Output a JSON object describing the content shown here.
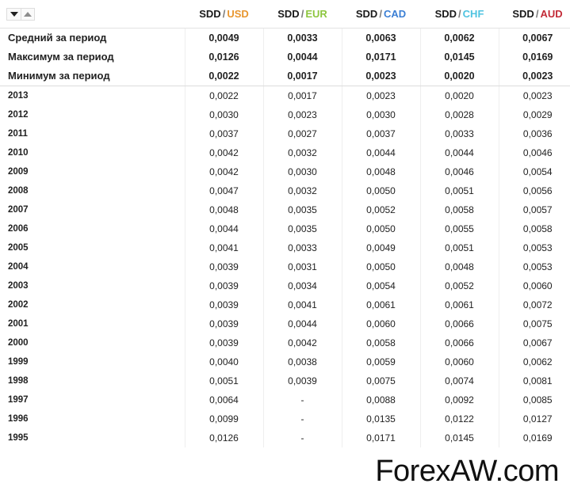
{
  "header": {
    "sort_desc_label": "▼",
    "sort_asc_label": "▲",
    "columns": [
      {
        "base": "SDD",
        "separator": "/",
        "quote": "USD",
        "color": "#E8962E"
      },
      {
        "base": "SDD",
        "separator": "/",
        "quote": "EUR",
        "color": "#8DC63F"
      },
      {
        "base": "SDD",
        "separator": "/",
        "quote": "CAD",
        "color": "#3B7FD4"
      },
      {
        "base": "SDD",
        "separator": "/",
        "quote": "CHF",
        "color": "#4EC3E0"
      },
      {
        "base": "SDD",
        "separator": "/",
        "quote": "AUD",
        "color": "#C32B38"
      }
    ]
  },
  "summary_rows": [
    {
      "label": "Средний за период",
      "values": [
        "0,0049",
        "0,0033",
        "0,0063",
        "0,0062",
        "0,0067"
      ]
    },
    {
      "label": "Максимум за период",
      "values": [
        "0,0126",
        "0,0044",
        "0,0171",
        "0,0145",
        "0,0169"
      ]
    },
    {
      "label": "Минимум за период",
      "values": [
        "0,0022",
        "0,0017",
        "0,0023",
        "0,0020",
        "0,0023"
      ]
    }
  ],
  "year_rows": [
    {
      "label": "2013",
      "values": [
        "0,0022",
        "0,0017",
        "0,0023",
        "0,0020",
        "0,0023"
      ]
    },
    {
      "label": "2012",
      "values": [
        "0,0030",
        "0,0023",
        "0,0030",
        "0,0028",
        "0,0029"
      ]
    },
    {
      "label": "2011",
      "values": [
        "0,0037",
        "0,0027",
        "0,0037",
        "0,0033",
        "0,0036"
      ]
    },
    {
      "label": "2010",
      "values": [
        "0,0042",
        "0,0032",
        "0,0044",
        "0,0044",
        "0,0046"
      ]
    },
    {
      "label": "2009",
      "values": [
        "0,0042",
        "0,0030",
        "0,0048",
        "0,0046",
        "0,0054"
      ]
    },
    {
      "label": "2008",
      "values": [
        "0,0047",
        "0,0032",
        "0,0050",
        "0,0051",
        "0,0056"
      ]
    },
    {
      "label": "2007",
      "values": [
        "0,0048",
        "0,0035",
        "0,0052",
        "0,0058",
        "0,0057"
      ]
    },
    {
      "label": "2006",
      "values": [
        "0,0044",
        "0,0035",
        "0,0050",
        "0,0055",
        "0,0058"
      ]
    },
    {
      "label": "2005",
      "values": [
        "0,0041",
        "0,0033",
        "0,0049",
        "0,0051",
        "0,0053"
      ]
    },
    {
      "label": "2004",
      "values": [
        "0,0039",
        "0,0031",
        "0,0050",
        "0,0048",
        "0,0053"
      ]
    },
    {
      "label": "2003",
      "values": [
        "0,0039",
        "0,0034",
        "0,0054",
        "0,0052",
        "0,0060"
      ]
    },
    {
      "label": "2002",
      "values": [
        "0,0039",
        "0,0041",
        "0,0061",
        "0,0061",
        "0,0072"
      ]
    },
    {
      "label": "2001",
      "values": [
        "0,0039",
        "0,0044",
        "0,0060",
        "0,0066",
        "0,0075"
      ]
    },
    {
      "label": "2000",
      "values": [
        "0,0039",
        "0,0042",
        "0,0058",
        "0,0066",
        "0,0067"
      ]
    },
    {
      "label": "1999",
      "values": [
        "0,0040",
        "0,0038",
        "0,0059",
        "0,0060",
        "0,0062"
      ]
    },
    {
      "label": "1998",
      "values": [
        "0,0051",
        "0,0039",
        "0,0075",
        "0,0074",
        "0,0081"
      ]
    },
    {
      "label": "1997",
      "values": [
        "0,0064",
        "-",
        "0,0088",
        "0,0092",
        "0,0085"
      ]
    },
    {
      "label": "1996",
      "values": [
        "0,0099",
        "-",
        "0,0135",
        "0,0122",
        "0,0127"
      ]
    },
    {
      "label": "1995",
      "values": [
        "0,0126",
        "-",
        "0,0171",
        "0,0145",
        "0,0169"
      ]
    }
  ],
  "watermark": {
    "text": "ForexAW.com"
  }
}
